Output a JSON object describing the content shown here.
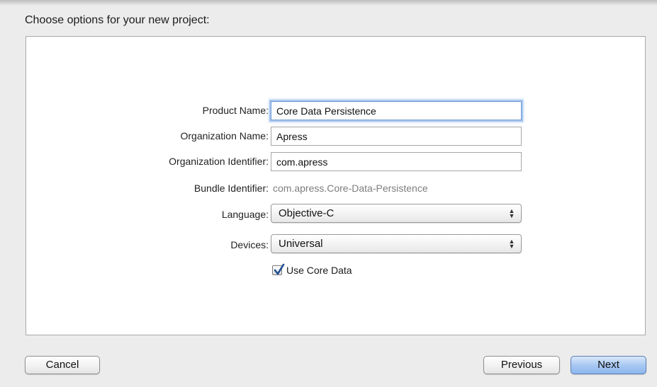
{
  "dialog": {
    "heading": "Choose options for your new project:"
  },
  "form": {
    "product_name": {
      "label": "Product Name:",
      "value": "Core Data Persistence"
    },
    "organization_name": {
      "label": "Organization Name:",
      "value": "Apress"
    },
    "organization_identifier": {
      "label": "Organization Identifier:",
      "value": "com.apress"
    },
    "bundle_identifier": {
      "label": "Bundle Identifier:",
      "value": "com.apress.Core-Data-Persistence"
    },
    "language": {
      "label": "Language:",
      "selected": "Objective-C"
    },
    "devices": {
      "label": "Devices:",
      "selected": "Universal"
    },
    "use_core_data": {
      "label": "Use Core Data",
      "checked": true
    }
  },
  "buttons": {
    "cancel": "Cancel",
    "previous": "Previous",
    "next": "Next"
  },
  "colors": {
    "focus_ring": "#6f9bd8",
    "default_button": "#8cb6ee",
    "checkmark": "#1f4e8f"
  },
  "icons": {
    "popup_arrows": "up-down-chevrons-icon",
    "check": "checkmark-icon"
  }
}
